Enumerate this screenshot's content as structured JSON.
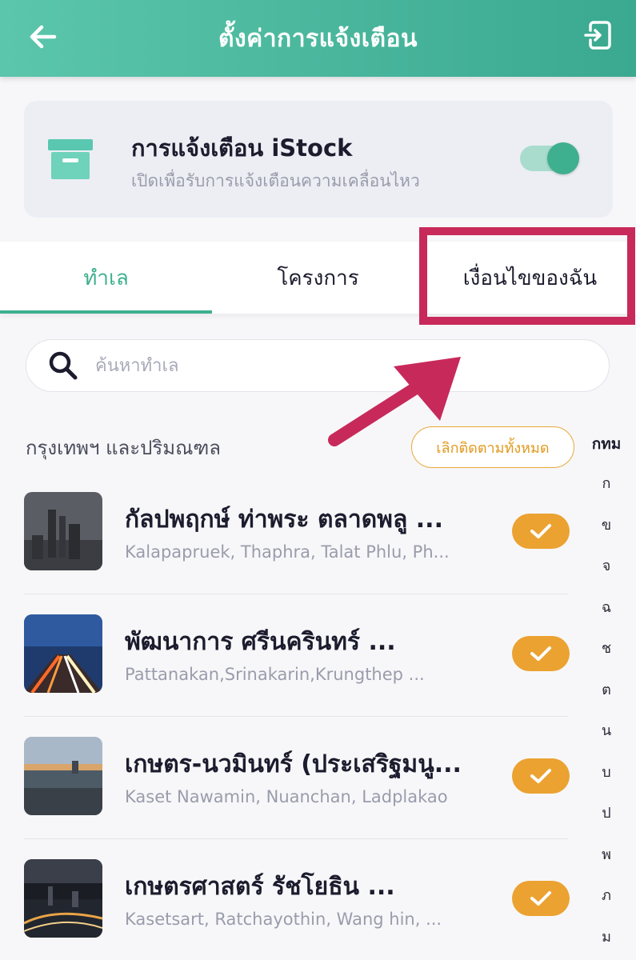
{
  "header": {
    "title": "ตั้งค่าการแจ้งเตือน",
    "back_icon": "arrow-left-icon",
    "exit_icon": "exit-icon"
  },
  "notification": {
    "title": "การแจ้งเตือน iStock",
    "subtitle": "เปิดเพื่อรับการแจ้งเตือนความเคลื่อนไหว",
    "enabled": true,
    "accent": "#3fb08f"
  },
  "tabs": [
    {
      "label": "ทำเล",
      "active": true
    },
    {
      "label": "โครงการ",
      "active": false
    },
    {
      "label": "เงื่อนไขของฉัน",
      "active": false
    }
  ],
  "search": {
    "placeholder": "ค้นหาทำเล"
  },
  "section": {
    "title": "กรุงเทพฯ และปริมณฑล",
    "unfollow_label": "เลิกติดตามทั้งหมด"
  },
  "index": {
    "head": "กทม",
    "letters": [
      "ก",
      "ข",
      "จ",
      "ฉ",
      "ช",
      "ต",
      "น",
      "บ",
      "ป",
      "พ",
      "ภ",
      "ม"
    ]
  },
  "locations": [
    {
      "title": "กัลปพฤกษ์ ท่าพระ ตลาดพลู ...",
      "subtitle": "Kalapapruek, Thaphra, Talat Phlu, Ph...",
      "followed": true
    },
    {
      "title": "พัฒนาการ ศรีนครินทร์ ...",
      "subtitle": "Pattanakan,Srinakarin,Krungthep ...",
      "followed": true
    },
    {
      "title": "เกษตร-นวมินทร์ (ประเสริฐมนู...",
      "subtitle": "Kaset Nawamin, Nuanchan, Ladplakao",
      "followed": true
    },
    {
      "title": "เกษตรศาสตร์ รัชโยธิน ...",
      "subtitle": "Kasetsart, Ratchayothin, Wang hin, ...",
      "followed": true
    }
  ],
  "colors": {
    "header_start": "#5bc6ac",
    "header_end": "#3aa98f",
    "highlight": "#c72a5a",
    "check": "#eba231"
  }
}
